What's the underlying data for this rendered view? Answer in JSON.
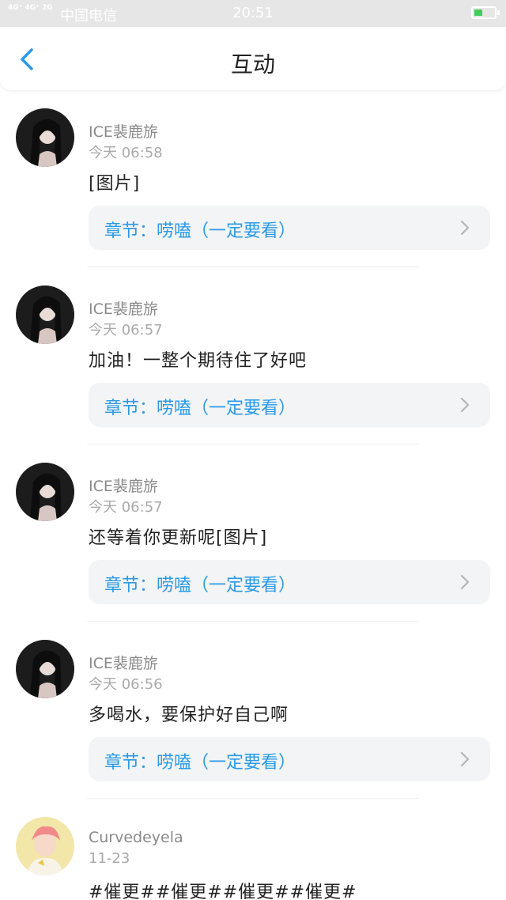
{
  "status_bar": {
    "signal_text": "4G⁺ 4G⁺ 2G",
    "carrier": "中国电信",
    "time": "20:51"
  },
  "navbar": {
    "title": "互动"
  },
  "items": [
    {
      "username": "ICE裴鹿旂",
      "time": "今天 06:58",
      "content": "[图片]",
      "chapter": "章节：唠嗑（一定要看）"
    },
    {
      "username": "ICE裴鹿旂",
      "time": "今天 06:57",
      "content": "加油！一整个期待住了好吧",
      "chapter": "章节：唠嗑（一定要看）"
    },
    {
      "username": "ICE裴鹿旂",
      "time": "今天 06:57",
      "content": "还等着你更新呢[图片]",
      "chapter": "章节：唠嗑（一定要看）"
    },
    {
      "username": "ICE裴鹿旂",
      "time": "今天 06:56",
      "content": "多喝水，要保护好自己啊",
      "chapter": "章节：唠嗑（一定要看）"
    },
    {
      "username": "Curvedeyela",
      "time": "11-23",
      "content": "#催更##催更##催更##催更#"
    }
  ],
  "colors": {
    "accent": "#2a9ae6",
    "chapter_bg": "#f3f4f5",
    "status_bar_bg": "#e6e6e6"
  }
}
